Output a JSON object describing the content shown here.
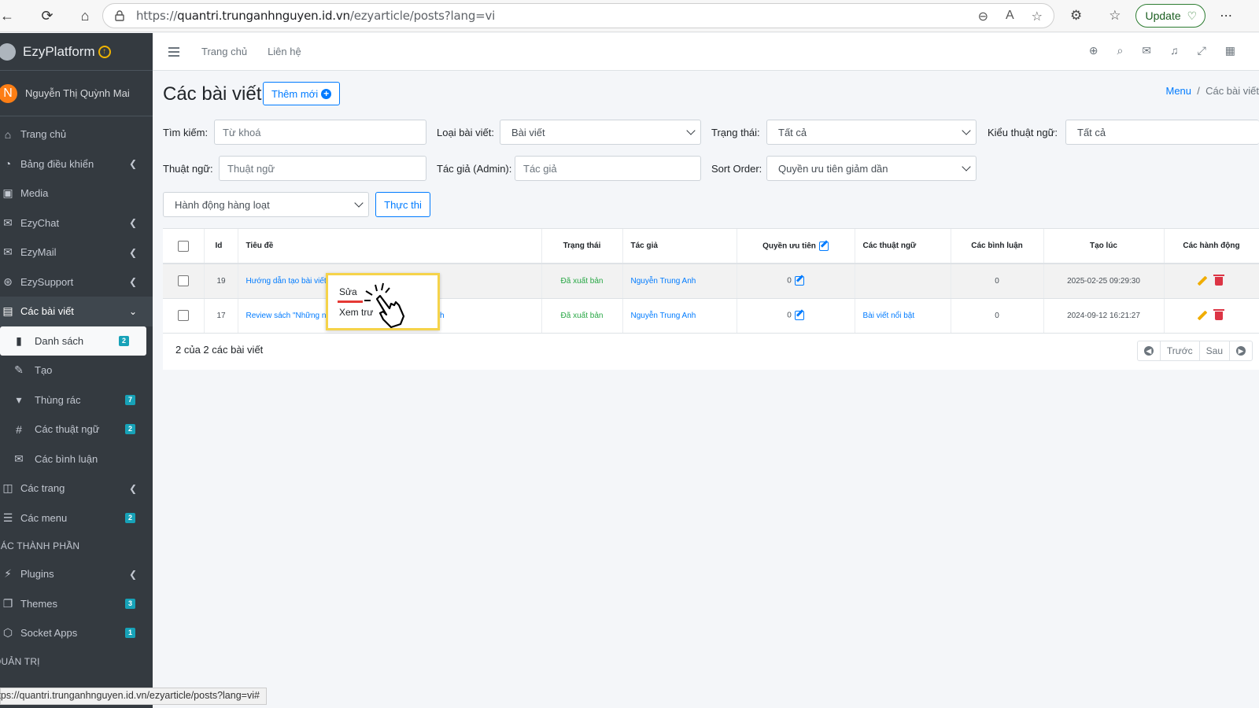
{
  "browser": {
    "url_prefix": "https://",
    "url_host": "quantri.trunganhnguyen.id.vn",
    "url_path": "/ezyarticle/posts?lang=vi",
    "update_label": "Update"
  },
  "sidebar": {
    "brand": "EzyPlatform",
    "user_initial": "N",
    "user_name": "Nguyễn Thị Quỳnh Mai",
    "items": [
      {
        "label": "Trang chủ"
      },
      {
        "label": "Bảng điều khiển"
      },
      {
        "label": "Media"
      },
      {
        "label": "EzyChat"
      },
      {
        "label": "EzyMail"
      },
      {
        "label": "EzySupport"
      },
      {
        "label": "Các bài viết"
      },
      {
        "label": "Danh sách",
        "badge": "2"
      },
      {
        "label": "Tạo"
      },
      {
        "label": "Thùng rác",
        "badge": "7"
      },
      {
        "label": "Các thuật ngữ",
        "badge": "2"
      },
      {
        "label": "Các bình luận"
      },
      {
        "label": "Các trang"
      },
      {
        "label": "Các menu",
        "badge": "2"
      },
      {
        "label": "CÁC THÀNH PHẦN"
      },
      {
        "label": "Plugins"
      },
      {
        "label": "Themes",
        "badge": "3"
      },
      {
        "label": "Socket Apps",
        "badge": "1"
      },
      {
        "label": "QUẢN TRỊ"
      }
    ]
  },
  "status_bar_url": "https://quantri.trunganhnguyen.id.vn/ezyarticle/posts?lang=vi#",
  "topnav": {
    "home": "Trang chủ",
    "contact": "Liên hệ"
  },
  "page": {
    "title": "Các bài viết",
    "add_new": "Thêm mới",
    "breadcrumb_menu": "Menu",
    "breadcrumb_current": "Các bài viết"
  },
  "filters": {
    "search_label": "Tìm kiếm:",
    "search_placeholder": "Từ khoá",
    "type_label": "Loại bài viết:",
    "type_value": "Bài viết",
    "status_label": "Trạng thái:",
    "status_value": "Tất cả",
    "term_type_label": "Kiểu thuật ngữ:",
    "term_type_value": "Tất cả",
    "term_label": "Thuật ngữ:",
    "term_placeholder": "Thuật ngữ",
    "author_label": "Tác giả (Admin):",
    "author_placeholder": "Tác giả",
    "sort_label": "Sort Order:",
    "sort_value": "Quyền ưu tiên giảm dần",
    "bulk_value": "Hành động hàng loạt",
    "execute": "Thực thi"
  },
  "table": {
    "headers": {
      "id": "Id",
      "title": "Tiêu đề",
      "status": "Trạng thái",
      "author": "Tác giả",
      "priority": "Quyền ưu tiên",
      "terms": "Các thuật ngữ",
      "comments": "Các bình luận",
      "created": "Tạo lúc",
      "actions": "Các hành động"
    },
    "rows": [
      {
        "id": "19",
        "title": "Hướng dẫn tạo bài viết",
        "status": "Đã xuất bản",
        "author": "Nguyễn Trung Anh",
        "priority": "0",
        "terms": "",
        "comments": "0",
        "created": "2025-02-25 09:29:30"
      },
      {
        "id": "17",
        "title": "Review sách \"Những n",
        "title_tail": "nh",
        "status": "Đã xuất bản",
        "author": "Nguyễn Trung Anh",
        "priority": "0",
        "terms": "Bài viết nổi bật",
        "comments": "0",
        "created": "2024-09-12 16:21:27"
      }
    ],
    "count": "2 của 2 các bài viết",
    "prev": "Trước",
    "next": "Sau"
  },
  "popup": {
    "edit": "Sửa",
    "preview": "Xem trư"
  }
}
